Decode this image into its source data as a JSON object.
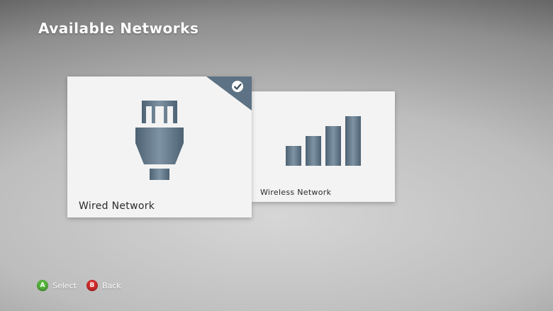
{
  "header": {
    "title": "Available Networks"
  },
  "networks": [
    {
      "label": "Wired Network",
      "icon": "ethernet-plug-icon",
      "selected": true
    },
    {
      "label": "Wireless Network",
      "icon": "signal-bars-icon",
      "selected": false
    }
  ],
  "footer": {
    "hints": [
      {
        "button": "A",
        "label": "Select",
        "color": "#55b43a"
      },
      {
        "button": "B",
        "label": "Back",
        "color": "#d22c2c"
      }
    ]
  },
  "colors": {
    "accent": "#5d7284",
    "tile": "#f3f3f3"
  }
}
